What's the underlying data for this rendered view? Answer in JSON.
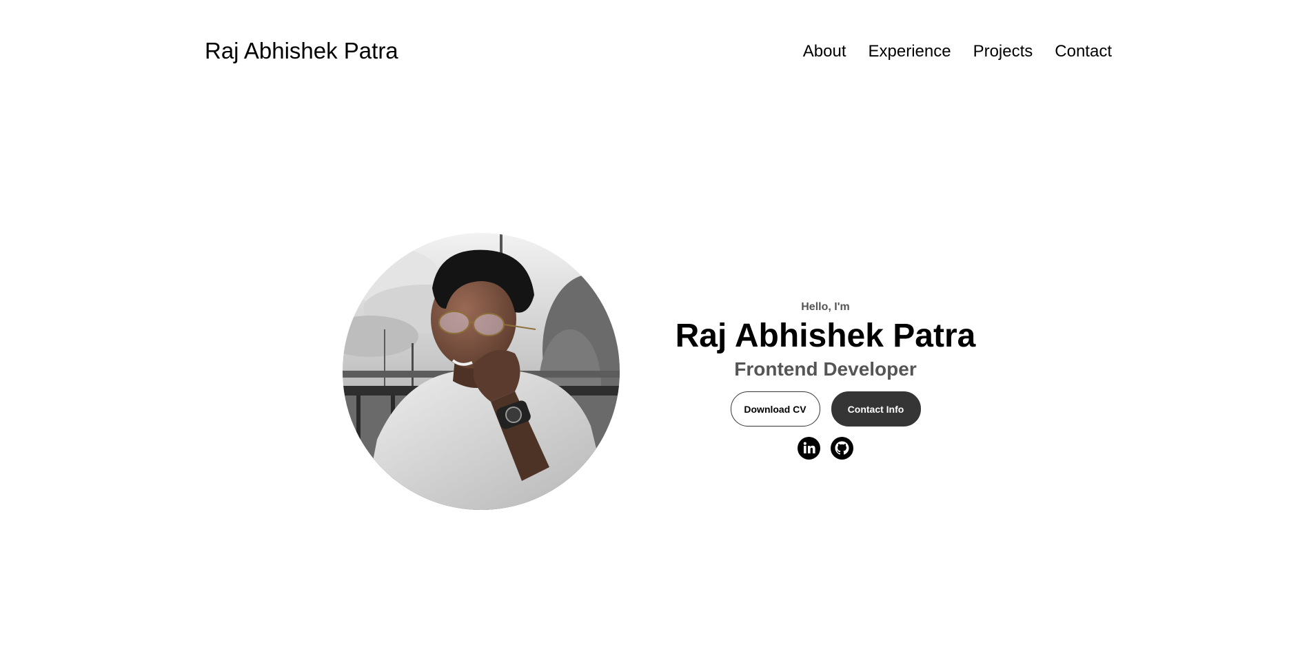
{
  "nav": {
    "logo": "Raj Abhishek Patra",
    "links": [
      "About",
      "Experience",
      "Projects",
      "Contact"
    ]
  },
  "hero": {
    "greeting": "Hello, I'm",
    "name": "Raj Abhishek Patra",
    "title": "Frontend Developer",
    "buttons": {
      "download_cv": "Download CV",
      "contact_info": "Contact Info"
    },
    "socials": [
      "linkedin-icon",
      "github-icon"
    ]
  },
  "colors": {
    "dark": "#353535",
    "muted_text": "#555555",
    "background": "#ffffff"
  }
}
